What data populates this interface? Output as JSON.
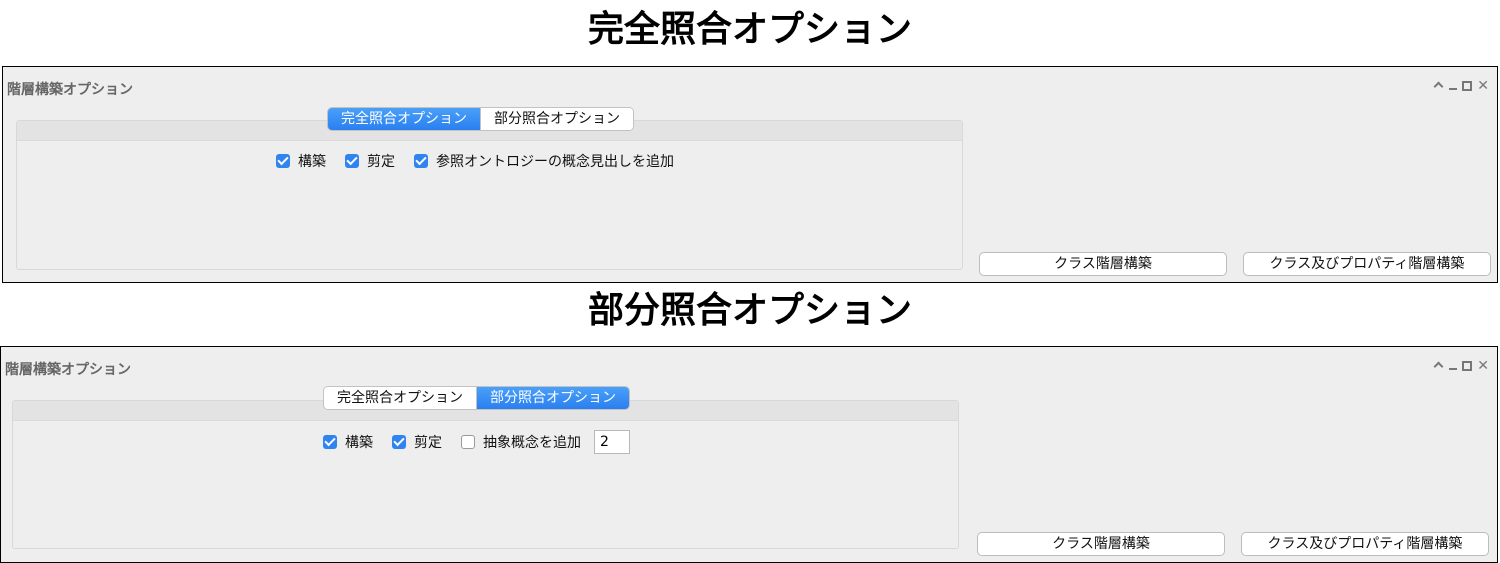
{
  "headings": {
    "exact": "完全照合オプション",
    "partial": "部分照合オプション"
  },
  "windows": [
    {
      "title": "階層構築オプション",
      "tabs": [
        {
          "label": "完全照合オプション",
          "active": true
        },
        {
          "label": "部分照合オプション",
          "active": false
        }
      ],
      "options": [
        {
          "label": "構築",
          "checked": true
        },
        {
          "label": "剪定",
          "checked": true
        },
        {
          "label": "参照オントロジーの概念見出しを追加",
          "checked": true
        }
      ],
      "buttons": {
        "class_hierarchy": "クラス階層構築",
        "class_property_hierarchy": "クラス及びプロパティ階層構築"
      }
    },
    {
      "title": "階層構築オプション",
      "tabs": [
        {
          "label": "完全照合オプション",
          "active": false
        },
        {
          "label": "部分照合オプション",
          "active": true
        }
      ],
      "options": [
        {
          "label": "構築",
          "checked": true
        },
        {
          "label": "剪定",
          "checked": true
        },
        {
          "label": "抽象概念を追加",
          "checked": false
        }
      ],
      "abstract_level_value": "2",
      "buttons": {
        "class_hierarchy": "クラス階層構築",
        "class_property_hierarchy": "クラス及びプロパティ階層構築"
      }
    }
  ],
  "icons": [
    "restore-icon",
    "minimize-icon",
    "maximize-icon",
    "close-icon",
    "checkbox-checked-icon",
    "checkbox-unchecked-icon"
  ],
  "colors": {
    "accent": "#2f84f0",
    "window_bg": "#eeeeee"
  }
}
